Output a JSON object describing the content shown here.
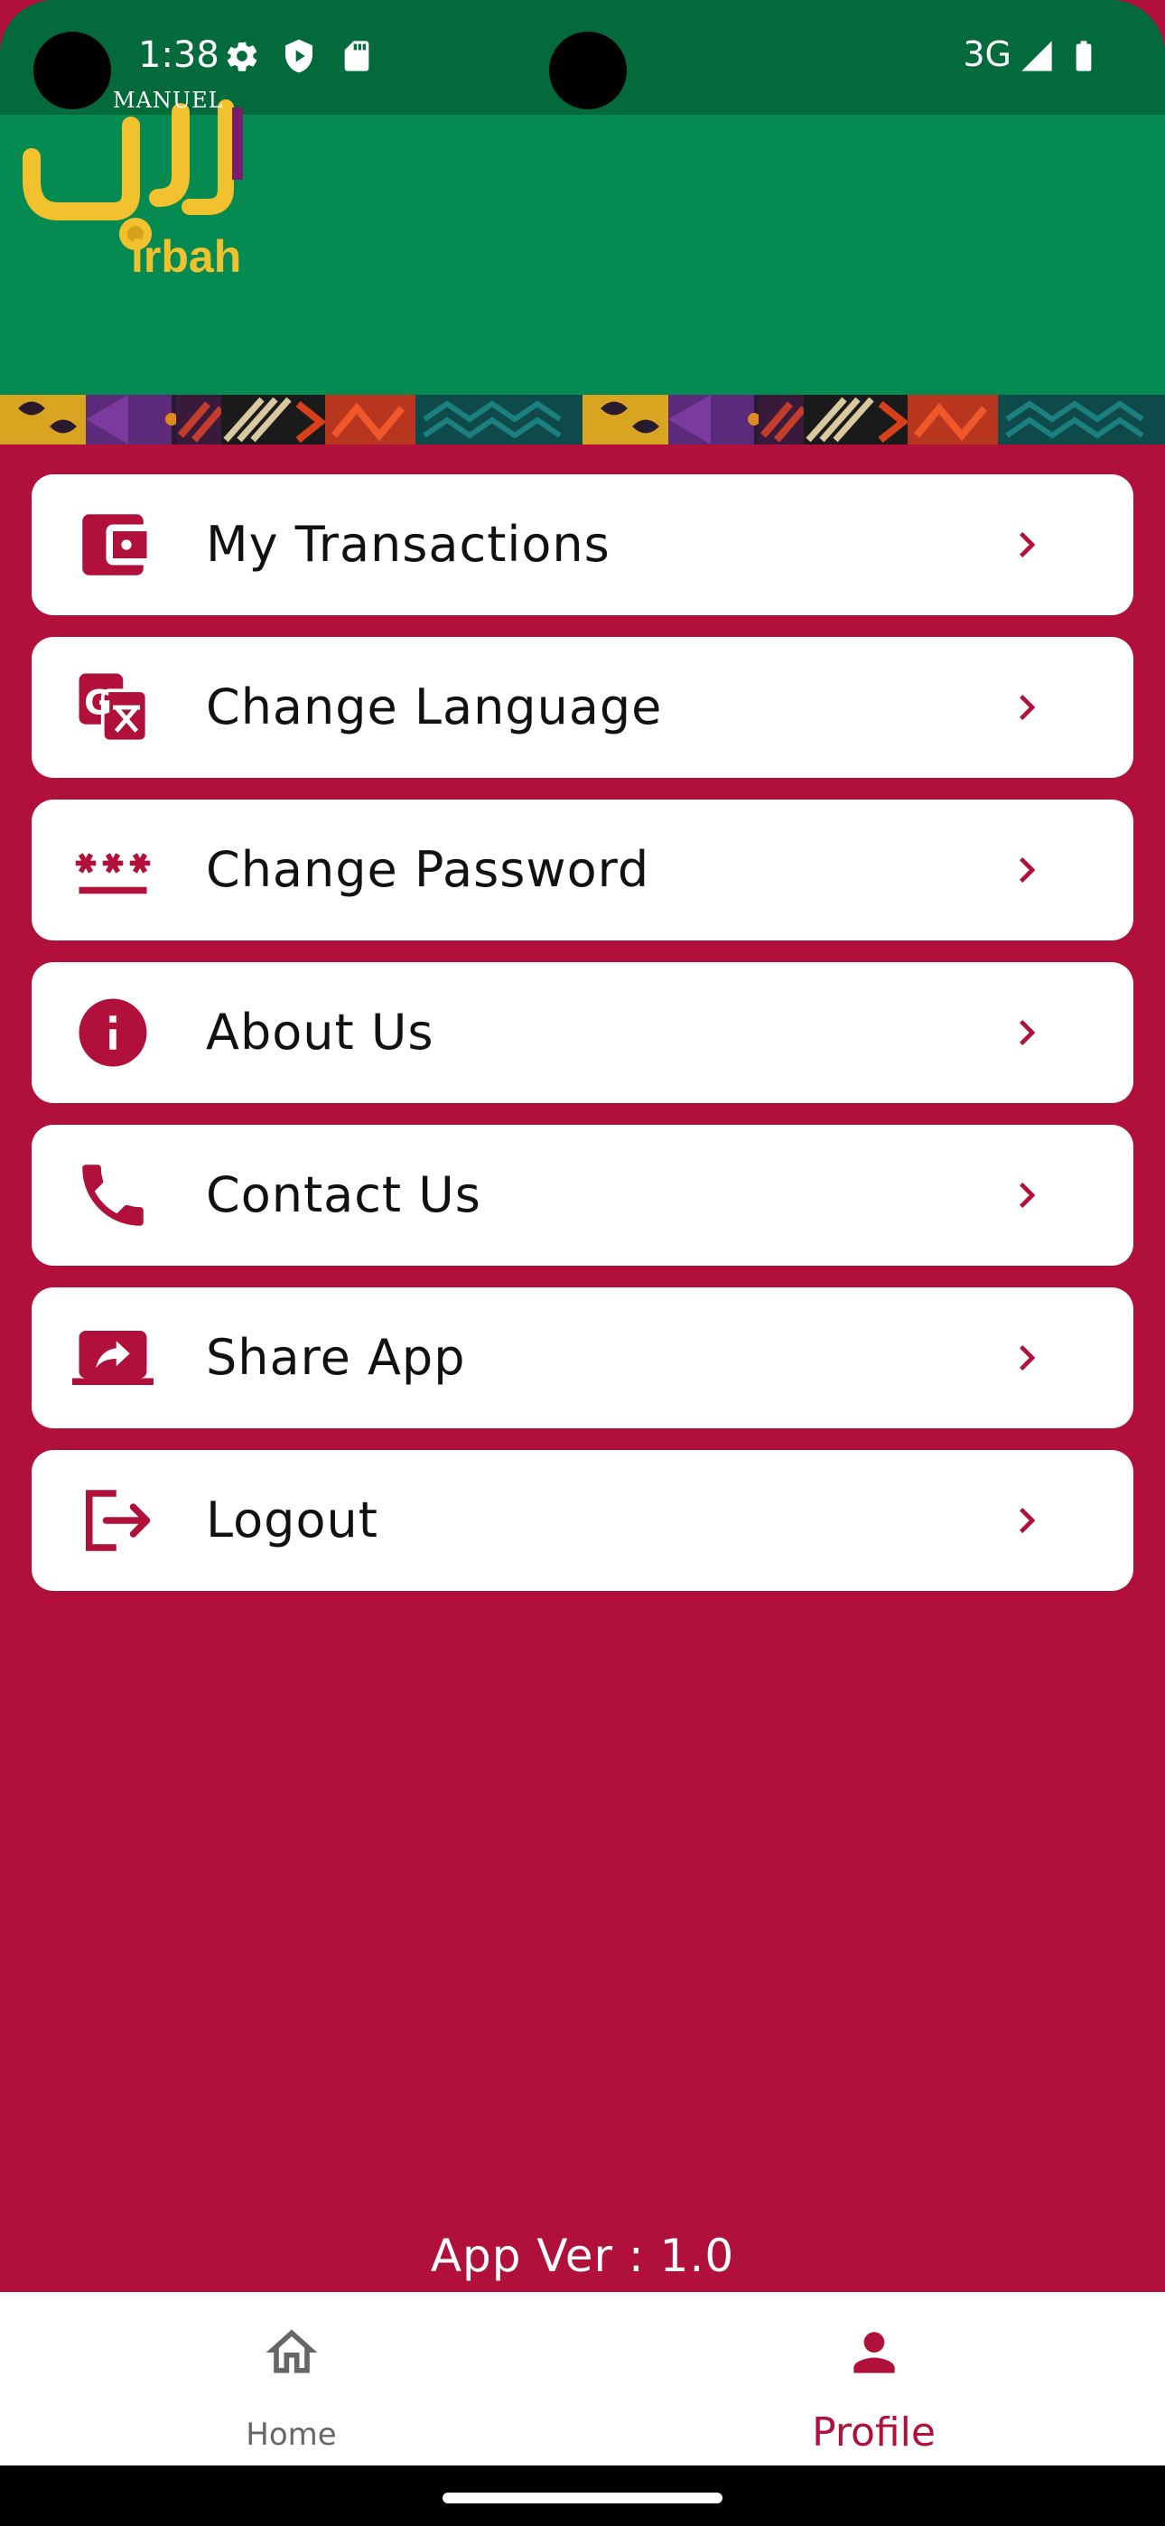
{
  "status_bar": {
    "time": "1:38",
    "network": "3G",
    "icons": [
      "gear-icon",
      "shield-play-icon",
      "sd-card-icon",
      "signal-icon",
      "battery-icon"
    ]
  },
  "header": {
    "logo_caption": "irbah",
    "logo_brand": "MANUEL",
    "background_color": "#058a51",
    "logo_color": "#f2c12e"
  },
  "menu": {
    "items": [
      {
        "label": "My Transactions",
        "icon": "wallet-icon"
      },
      {
        "label": "Change Language",
        "icon": "translate-icon"
      },
      {
        "label": "Change Password",
        "icon": "password-icon"
      },
      {
        "label": "About Us",
        "icon": "info-icon"
      },
      {
        "label": "Contact Us",
        "icon": "phone-icon"
      },
      {
        "label": "Share App",
        "icon": "share-laptop-icon"
      },
      {
        "label": "Logout",
        "icon": "logout-icon"
      }
    ]
  },
  "app_version": "App Ver : 1.0",
  "bottom_nav": {
    "items": [
      {
        "label": "Home",
        "icon": "home-icon",
        "active": false
      },
      {
        "label": "Profile",
        "icon": "person-icon",
        "active": true
      }
    ]
  },
  "colors": {
    "primary": "#b01039",
    "card": "#ffffff",
    "status_bar": "#036a3c",
    "inactive_nav": "#666666"
  }
}
